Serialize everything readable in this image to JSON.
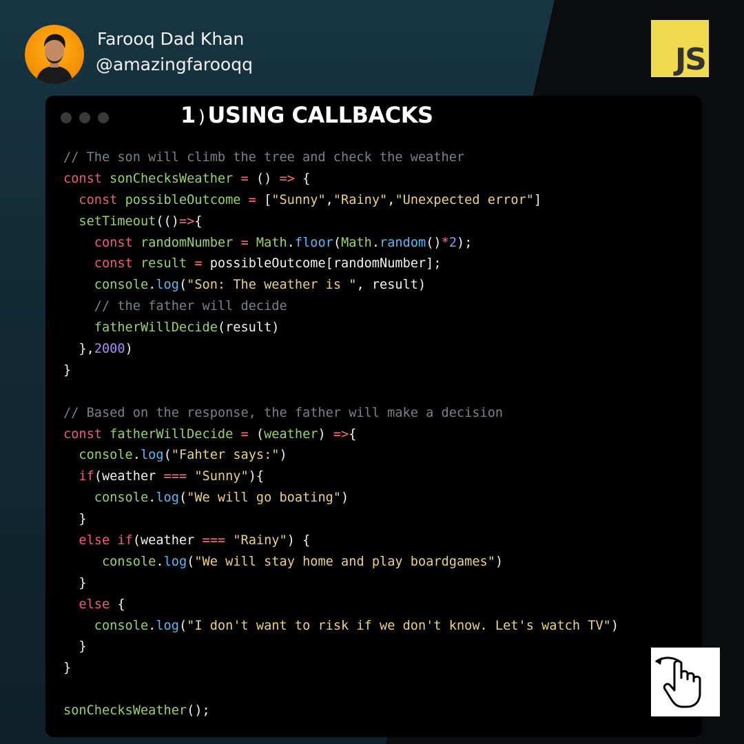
{
  "author": {
    "name": "Farooq Dad Khan",
    "handle": "@amazingfarooqq"
  },
  "logo": {
    "text": "JS",
    "color": "#f0db4f"
  },
  "card": {
    "number": "1",
    "paren": ")",
    "title": "USING CALLBACKS"
  },
  "icons": {
    "avatar": "profile-photo",
    "swipe": "swipe-hand-icon"
  },
  "code_lines": [
    [
      [
        "cm",
        "// The son will climb the tree and check the weather"
      ]
    ],
    [
      [
        "kw",
        "const "
      ],
      [
        "fn",
        "sonChecksWeather"
      ],
      [
        "op",
        " = "
      ],
      [
        "pl",
        "() "
      ],
      [
        "op",
        "=>"
      ],
      [
        "pl",
        " {"
      ]
    ],
    [
      [
        "pl",
        "  "
      ],
      [
        "kw",
        "const "
      ],
      [
        "fn",
        "possibleOutcome"
      ],
      [
        "op",
        " = "
      ],
      [
        "pl",
        "["
      ],
      [
        "st",
        "\"Sunny\""
      ],
      [
        "pl",
        ","
      ],
      [
        "st",
        "\"Rainy\""
      ],
      [
        "pl",
        ","
      ],
      [
        "st",
        "\"Unexpected error\""
      ],
      [
        "pl",
        "]"
      ]
    ],
    [
      [
        "pl",
        "  "
      ],
      [
        "fn",
        "setTimeout"
      ],
      [
        "pl",
        "(()"
      ],
      [
        "op",
        "=>"
      ],
      [
        "pl",
        "{"
      ]
    ],
    [
      [
        "pl",
        "    "
      ],
      [
        "kw",
        "const "
      ],
      [
        "fn",
        "randomNumber"
      ],
      [
        "op",
        " = "
      ],
      [
        "fn",
        "Math"
      ],
      [
        "pl",
        "."
      ],
      [
        "md",
        "floor"
      ],
      [
        "pl",
        "("
      ],
      [
        "fn",
        "Math"
      ],
      [
        "pl",
        "."
      ],
      [
        "md",
        "random"
      ],
      [
        "pl",
        "()"
      ],
      [
        "op",
        "*"
      ],
      [
        "nm",
        "2"
      ],
      [
        "pl",
        ");"
      ]
    ],
    [
      [
        "pl",
        "    "
      ],
      [
        "kw",
        "const "
      ],
      [
        "fn",
        "result"
      ],
      [
        "op",
        " = "
      ],
      [
        "pl",
        "possibleOutcome[randomNumber];"
      ]
    ],
    [
      [
        "pl",
        "    "
      ],
      [
        "fn",
        "console"
      ],
      [
        "pl",
        "."
      ],
      [
        "md",
        "log"
      ],
      [
        "pl",
        "("
      ],
      [
        "st",
        "\"Son: The weather is \""
      ],
      [
        "pl",
        ", result)"
      ]
    ],
    [
      [
        "pl",
        "    "
      ],
      [
        "cm",
        "// the father will decide"
      ]
    ],
    [
      [
        "pl",
        "    "
      ],
      [
        "fn",
        "fatherWillDecide"
      ],
      [
        "pl",
        "(result)"
      ]
    ],
    [
      [
        "pl",
        "  },"
      ],
      [
        "nm",
        "2000"
      ],
      [
        "pl",
        ")"
      ]
    ],
    [
      [
        "pl",
        "}"
      ]
    ],
    [
      [
        "pl",
        ""
      ]
    ],
    [
      [
        "cm",
        "// Based on the response, the father will make a decision"
      ]
    ],
    [
      [
        "kw",
        "const "
      ],
      [
        "fn",
        "fatherWillDecide"
      ],
      [
        "op",
        " = "
      ],
      [
        "pl",
        "("
      ],
      [
        "fn",
        "weather"
      ],
      [
        "pl",
        ") "
      ],
      [
        "op",
        "=>"
      ],
      [
        "pl",
        "{"
      ]
    ],
    [
      [
        "pl",
        "  "
      ],
      [
        "fn",
        "console"
      ],
      [
        "pl",
        "."
      ],
      [
        "md",
        "log"
      ],
      [
        "pl",
        "("
      ],
      [
        "st",
        "\"Fahter says:\""
      ],
      [
        "pl",
        ")"
      ]
    ],
    [
      [
        "pl",
        "  "
      ],
      [
        "kw",
        "if"
      ],
      [
        "pl",
        "(weather "
      ],
      [
        "op",
        "==="
      ],
      [
        "pl",
        " "
      ],
      [
        "st",
        "\"Sunny\""
      ],
      [
        "pl",
        "){"
      ]
    ],
    [
      [
        "pl",
        "    "
      ],
      [
        "fn",
        "console"
      ],
      [
        "pl",
        "."
      ],
      [
        "md",
        "log"
      ],
      [
        "pl",
        "("
      ],
      [
        "st",
        "\"We will go boating\""
      ],
      [
        "pl",
        ")"
      ]
    ],
    [
      [
        "pl",
        "  }"
      ]
    ],
    [
      [
        "pl",
        "  "
      ],
      [
        "kw",
        "else if"
      ],
      [
        "pl",
        "(weather "
      ],
      [
        "op",
        "==="
      ],
      [
        "pl",
        " "
      ],
      [
        "st",
        "\"Rainy\""
      ],
      [
        "pl",
        ") {"
      ]
    ],
    [
      [
        "pl",
        "     "
      ],
      [
        "fn",
        "console"
      ],
      [
        "pl",
        "."
      ],
      [
        "md",
        "log"
      ],
      [
        "pl",
        "("
      ],
      [
        "st",
        "\"We will stay home and play boardgames\""
      ],
      [
        "pl",
        ")"
      ]
    ],
    [
      [
        "pl",
        "  }"
      ]
    ],
    [
      [
        "pl",
        "  "
      ],
      [
        "kw",
        "else"
      ],
      [
        "pl",
        " {"
      ]
    ],
    [
      [
        "pl",
        "    "
      ],
      [
        "fn",
        "console"
      ],
      [
        "pl",
        "."
      ],
      [
        "md",
        "log"
      ],
      [
        "pl",
        "("
      ],
      [
        "st",
        "\"I don't want to risk if we don't know. Let's watch TV\""
      ],
      [
        "pl",
        ")"
      ]
    ],
    [
      [
        "pl",
        "  }"
      ]
    ],
    [
      [
        "pl",
        "}"
      ]
    ],
    [
      [
        "pl",
        ""
      ]
    ],
    [
      [
        "fn",
        "sonChecksWeather"
      ],
      [
        "pl",
        "();"
      ]
    ]
  ]
}
